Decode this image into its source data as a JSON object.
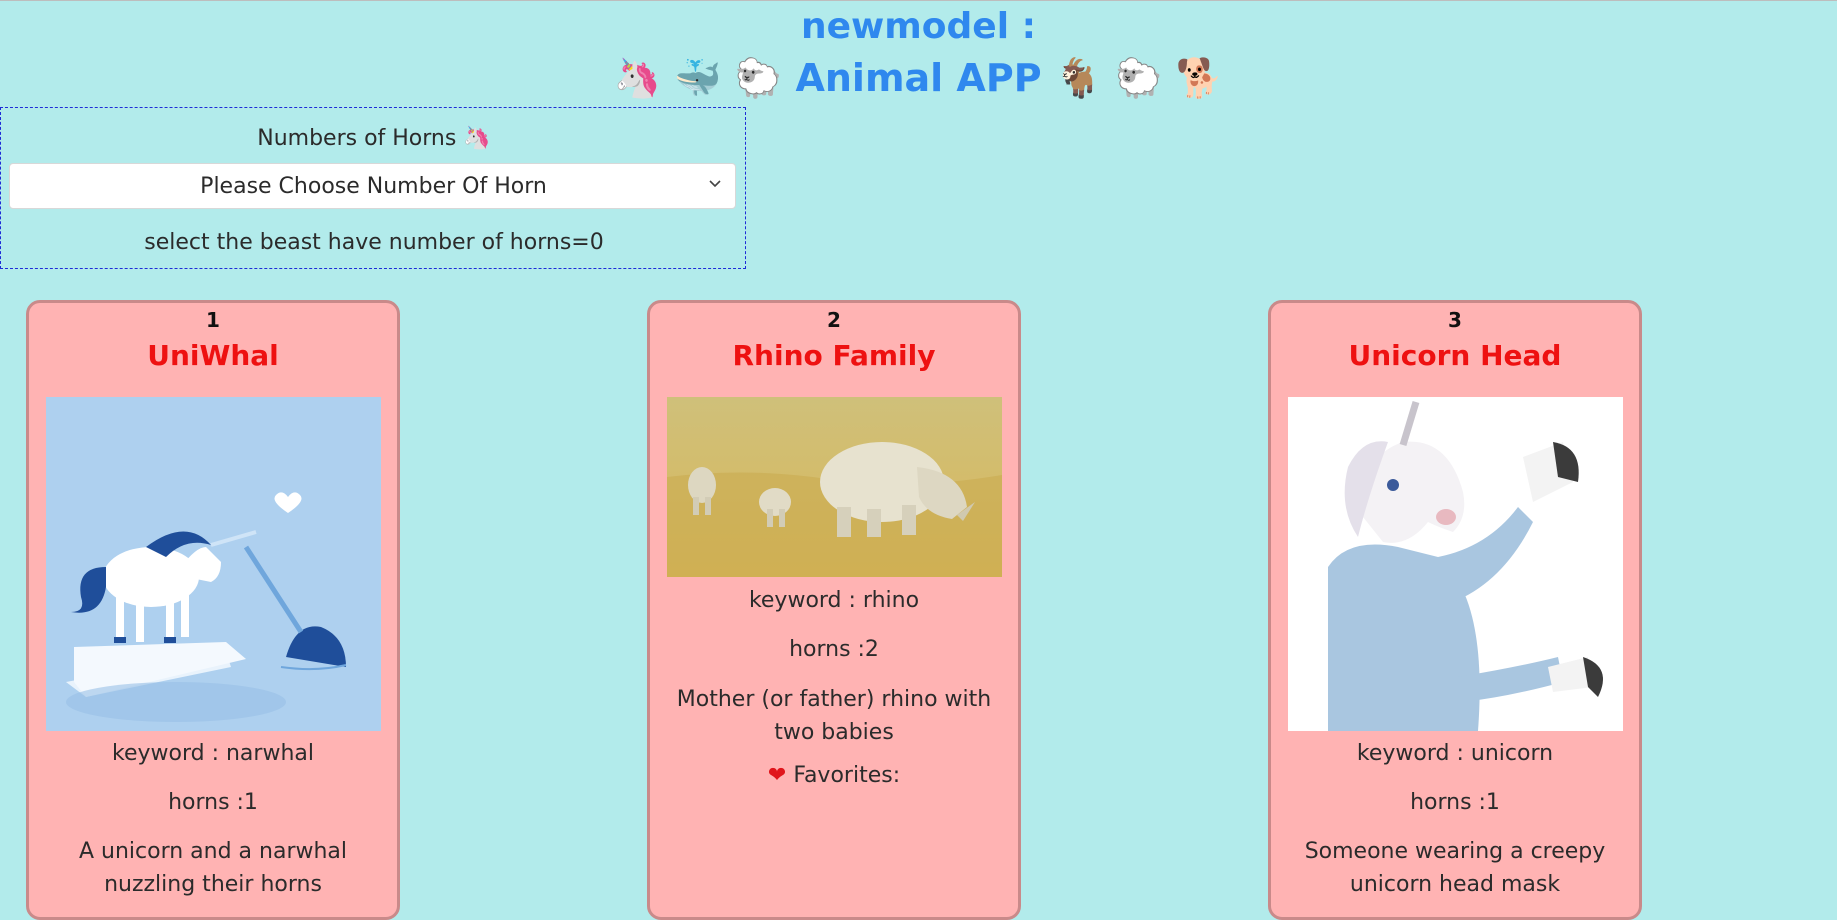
{
  "header": {
    "title": "newmodel :",
    "subtitle": "Animal APP",
    "left_emojis": [
      "🦄",
      "🐳",
      "🐑"
    ],
    "right_emojis": [
      "🐐",
      "🐑",
      "🐕"
    ]
  },
  "filter": {
    "label": "Numbers of Horns",
    "label_emoji": "🦄",
    "select_value": "Please Choose Number Of Horn",
    "hint": "select the beast have number of horns=0"
  },
  "cards": [
    {
      "number": "1",
      "title": "UniWhal",
      "keyword": "keyword : narwhal",
      "horns": "horns :1",
      "description": "A unicorn and a narwhal nuzzling their horns",
      "image": "unicorn-narwhal-illustration"
    },
    {
      "number": "2",
      "title": "Rhino Family",
      "keyword": "keyword : rhino",
      "horns": "horns :2",
      "description": "Mother (or father) rhino with two babies",
      "favorites": "Favorites:",
      "image": "rhino-family-photo"
    },
    {
      "number": "3",
      "title": "Unicorn Head",
      "keyword": "keyword : unicorn",
      "horns": "horns :1",
      "description": "Someone wearing a creepy unicorn head mask",
      "image": "unicorn-mask-photo"
    }
  ],
  "colors": {
    "background": "#b2ebeb",
    "heading": "#2f88ee",
    "card_bg": "#ffb3b3",
    "card_title": "#ee1111"
  }
}
